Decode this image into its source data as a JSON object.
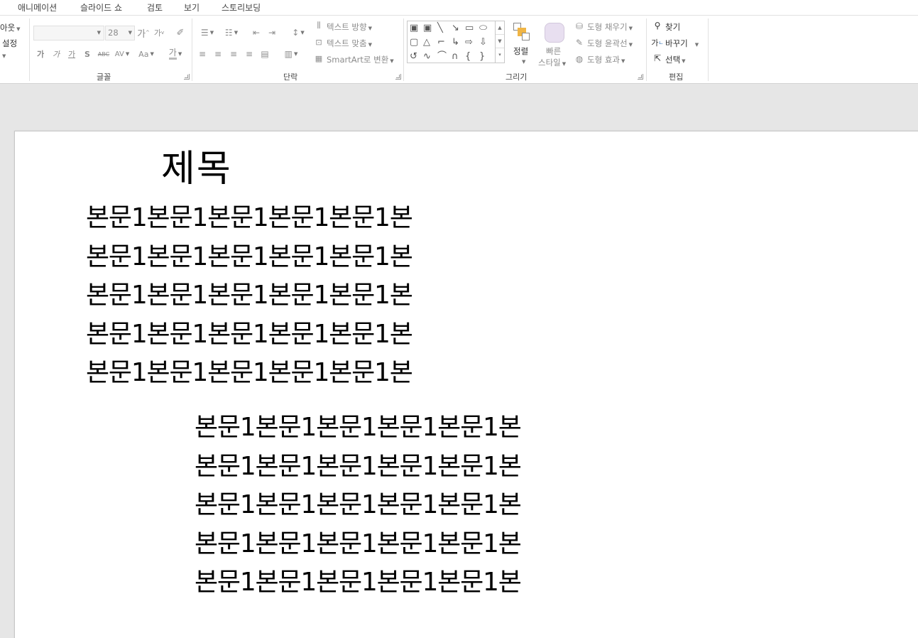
{
  "tabs": [
    "애니메이션",
    "슬라이드 쇼",
    "검토",
    "보기",
    "스토리보딩"
  ],
  "ribbon": {
    "slides_group": {
      "layout_label": "아웃",
      "reset_label": "설정"
    },
    "font_group": {
      "label": "글꼴",
      "font_size": "28",
      "buttons": [
        "가",
        "가",
        "가",
        "S",
        "ABC",
        "AV",
        "Aa",
        "가"
      ]
    },
    "paragraph_group": {
      "label": "단락",
      "text_direction": "텍스트 방향",
      "align_text": "텍스트 맞춤",
      "smartart": "SmartArt로 변환"
    },
    "drawing_group": {
      "label": "그리기",
      "arrange": "정렬",
      "quick_styles_line1": "빠른",
      "quick_styles_line2": "스타일",
      "shape_fill": "도형 채우기",
      "shape_outline": "도형 윤곽선",
      "shape_effects": "도형 효과"
    },
    "editing_group": {
      "label": "편집",
      "find": "찾기",
      "replace": "바꾸기",
      "select": "선택"
    }
  },
  "slide": {
    "title": "제목",
    "body_block_1": [
      "본문1본문1본문1본문1본문1본",
      "본문1본문1본문1본문1본문1본",
      "본문1본문1본문1본문1본문1본",
      "본문1본문1본문1본문1본문1본",
      "본문1본문1본문1본문1본문1본"
    ],
    "body_block_2": [
      "본문1본문1본문1본문1본문1본",
      "본문1본문1본문1본문1본문1본",
      "본문1본문1본문1본문1본문1본",
      "본문1본문1본문1본문1본문1본",
      "본문1본문1본문1본문1본문1본"
    ]
  },
  "colors": {
    "ribbon_bg": "#ffffff",
    "canvas_bg": "#e6e6e6",
    "slide_bg": "#ffffff",
    "arrange_icon_accent": "#f0b545",
    "quick_style_accent": "#e8dff0"
  }
}
